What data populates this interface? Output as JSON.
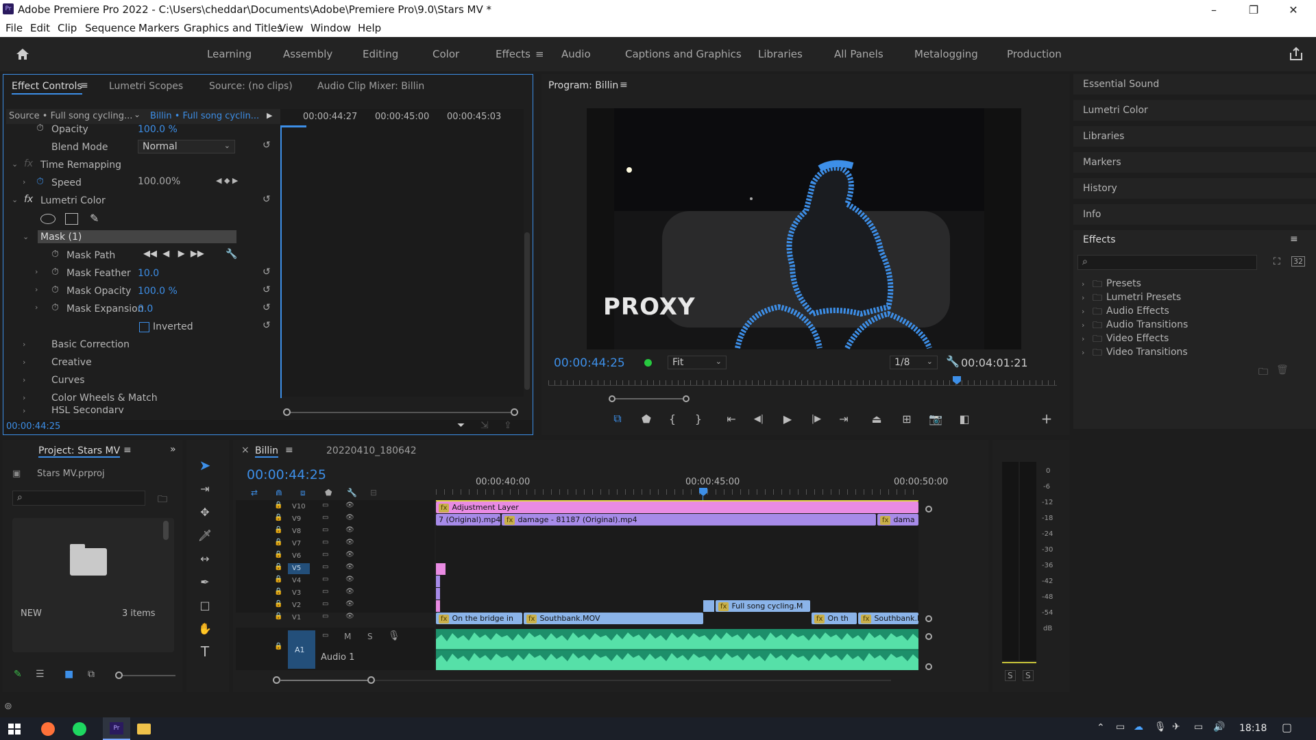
{
  "window": {
    "title": "Adobe Premiere Pro 2022 - C:\\Users\\cheddar\\Documents\\Adobe\\Premiere Pro\\9.0\\Stars MV *",
    "app_icon": "Pr",
    "minimize": "–",
    "maximize": "❐",
    "close": "✕"
  },
  "menu": [
    "File",
    "Edit",
    "Clip",
    "Sequence",
    "Markers",
    "Graphics and Titles",
    "View",
    "Window",
    "Help"
  ],
  "workspaces": [
    "Learning",
    "Assembly",
    "Editing",
    "Color",
    "Effects",
    "Audio",
    "Captions and Graphics",
    "Libraries",
    "All Panels",
    "Metalogging",
    "Production"
  ],
  "workspace_active": "Effects",
  "accent": "#3d8fe8",
  "effect_controls": {
    "tabs": [
      "Effect Controls",
      "Lumetri Scopes",
      "Source: (no clips)",
      "Audio Clip Mixer: Billin"
    ],
    "source_label": "Source • Full song cycling...",
    "sequence_label": "Billin • Full song cyclin...",
    "ruler_times": [
      "00:00:44:27",
      "00:00:45:00",
      "00:00:45:03"
    ],
    "opacity": {
      "label": "Opacity",
      "value": "100.0 %"
    },
    "blend_mode": {
      "label": "Blend Mode",
      "value": "Normal"
    },
    "time_remapping": "Time Remapping",
    "speed": {
      "label": "Speed",
      "value": "100.00%"
    },
    "lumetri": "Lumetri Color",
    "mask": "Mask (1)",
    "mask_path": "Mask Path",
    "mask_feather": {
      "label": "Mask Feather",
      "value": "10.0"
    },
    "mask_opacity": {
      "label": "Mask Opacity",
      "value": "100.0 %"
    },
    "mask_expansion": {
      "label": "Mask Expansion",
      "value": "0.0"
    },
    "inverted": "Inverted",
    "sections": [
      "Basic Correction",
      "Creative",
      "Curves",
      "Color Wheels & Match",
      "HSL Secondary"
    ],
    "timecode": "00:00:44:25"
  },
  "program": {
    "title": "Program: Billin",
    "timecode": "00:00:44:25",
    "fit": "Fit",
    "resolution": "1/8",
    "duration": "00:04:01:21",
    "overlay_text": "PROXY"
  },
  "right_panels": [
    "Essential Sound",
    "Lumetri Color",
    "Libraries",
    "Markers",
    "History",
    "Info"
  ],
  "effects_panel": {
    "title": "Effects",
    "items": [
      "Presets",
      "Lumetri Presets",
      "Audio Effects",
      "Audio Transitions",
      "Video Effects",
      "Video Transitions"
    ],
    "badge1": "32"
  },
  "project": {
    "tab": "Project: Stars MV",
    "file": "Stars MV.prproj",
    "bin_name": "NEW",
    "bin_count": "3 items"
  },
  "timeline": {
    "tabs": [
      "Billin",
      "20220410_180642"
    ],
    "timecode": "00:00:44:25",
    "ruler": [
      "00:00:40:00",
      "00:00:45:00",
      "00:00:50:00"
    ],
    "tracks": [
      "V10",
      "V9",
      "V8",
      "V7",
      "V6",
      "V5",
      "V4",
      "V3",
      "V2",
      "V1",
      "A1"
    ],
    "clips": {
      "adjustment": "Adjustment Layer",
      "v9a": "7 (Original).mp4",
      "v9b": "damage - 81187 (Original).mp4",
      "v9c": "dama",
      "v2": "Full song cycling.M",
      "v1a": "On the bridge in",
      "v1b": "Southbank.MOV",
      "v1c": "On th",
      "v1d": "Southbank.MOV"
    },
    "audio_label": "Audio 1",
    "a1": "A1",
    "m": "M",
    "s": "S"
  },
  "meter": {
    "db": [
      "0",
      "-6",
      "-12",
      "-18",
      "-24",
      "-30",
      "-36",
      "-42",
      "-48",
      "-54",
      "dB"
    ],
    "solo": [
      "S",
      "S"
    ]
  },
  "taskbar": {
    "time": "18:18"
  }
}
